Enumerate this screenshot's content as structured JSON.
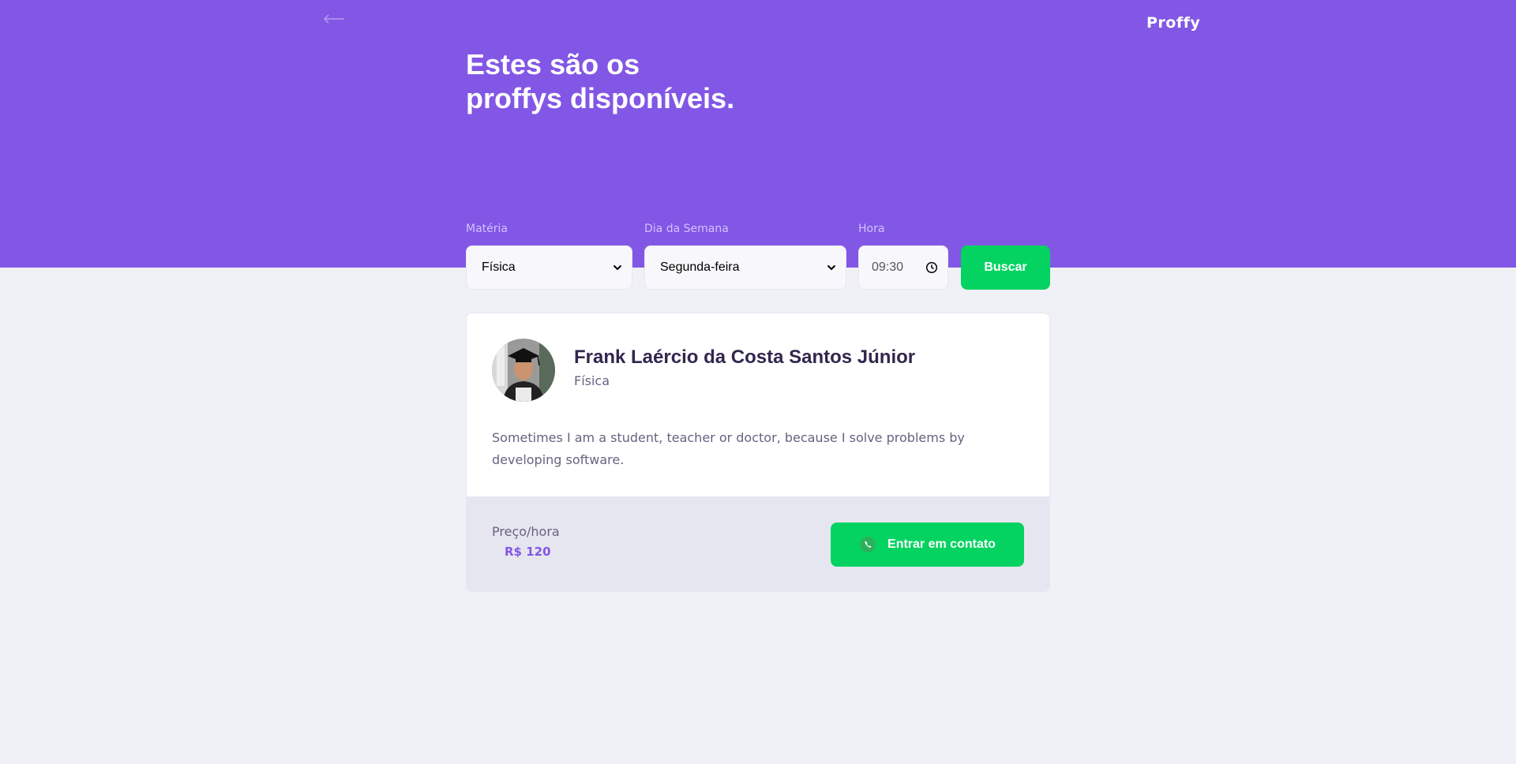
{
  "header": {
    "logo": "Proffy",
    "title_line1": "Estes são os",
    "title_line2": "proffys disponíveis."
  },
  "filters": {
    "subject": {
      "label": "Matéria",
      "value": "Física"
    },
    "weekday": {
      "label": "Dia da Semana",
      "value": "Segunda-feira"
    },
    "time": {
      "label": "Hora",
      "value": "09:30"
    },
    "search_label": "Buscar"
  },
  "teacher": {
    "name": "Frank Laércio da Costa Santos Júnior",
    "subject": "Física",
    "bio": "Sometimes I am a student, teacher or doctor, because I solve problems by developing software.",
    "price_label": "Preço/hora",
    "price_value": "R$ 120",
    "contact_label": "Entrar em contato"
  },
  "colors": {
    "primary": "#8257E5",
    "secondary": "#04D361",
    "background": "#F0F0F7",
    "title_text": "#32264D",
    "body_text": "#6A6180"
  },
  "icons": [
    "back-arrow-icon",
    "chevron-down-icon",
    "clock-icon",
    "whatsapp-icon"
  ]
}
